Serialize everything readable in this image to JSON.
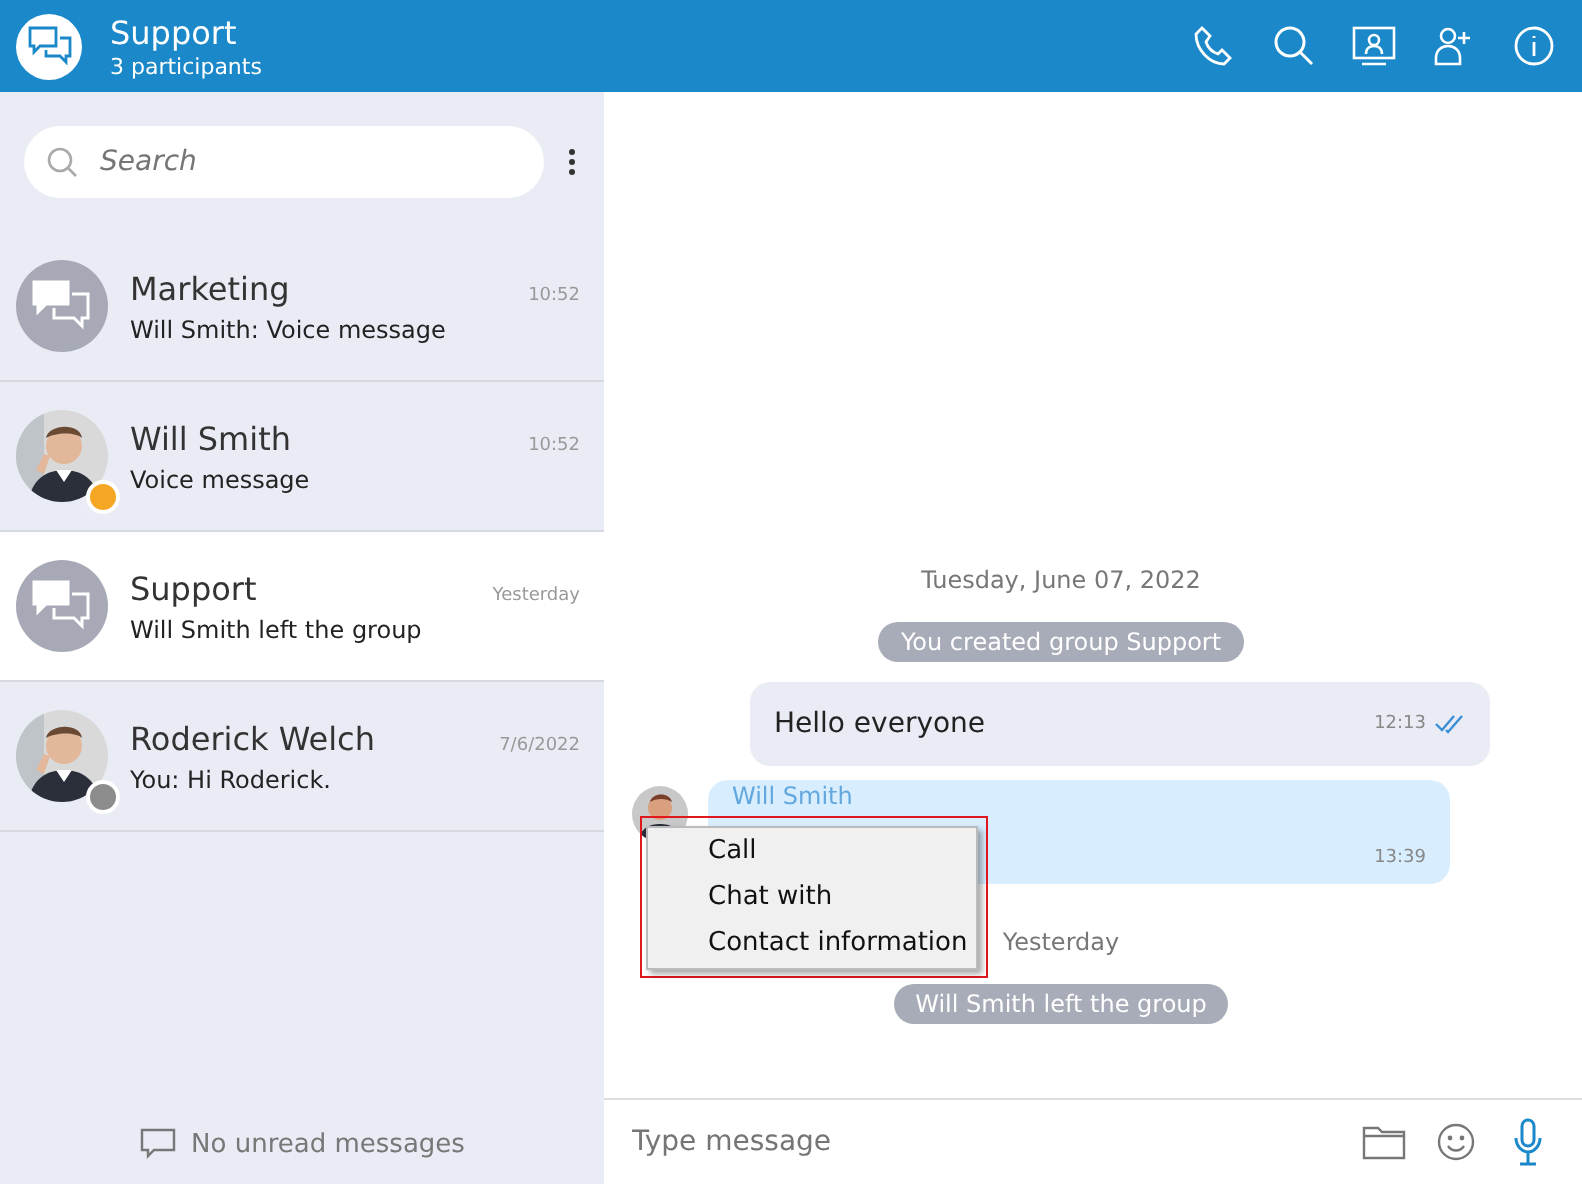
{
  "header": {
    "title": "Support",
    "subtitle": "3 participants"
  },
  "search": {
    "placeholder": "Search"
  },
  "chats": [
    {
      "name": "Marketing",
      "time": "10:52",
      "preview": "Will Smith: Voice message",
      "kind": "group",
      "selected": false
    },
    {
      "name": "Will Smith",
      "time": "10:52",
      "preview": "Voice message",
      "kind": "person",
      "color": "#f5a623",
      "selected": false
    },
    {
      "name": "Support",
      "time": "Yesterday",
      "preview": "Will Smith left the group",
      "kind": "group",
      "selected": true
    },
    {
      "name": "Roderick Welch",
      "time": "7/6/2022",
      "preview": "You: Hi Roderick.",
      "kind": "person",
      "color": "#8c8c8c",
      "selected": false
    }
  ],
  "unread_note": "No unread messages",
  "messages": [
    {
      "kind": "date",
      "text": "Tuesday, June 07, 2022"
    },
    {
      "kind": "event",
      "text": "You created group Support"
    },
    {
      "kind": "outgoing",
      "text": "Hello everyone",
      "time": "12:13",
      "read": true
    },
    {
      "kind": "incoming",
      "sender": "Will Smith",
      "time": "13:39"
    },
    {
      "kind": "date",
      "text": "Yesterday"
    },
    {
      "kind": "event",
      "text": "Will Smith left the group"
    }
  ],
  "context_menu": [
    "Call",
    "Chat with",
    "Contact information"
  ],
  "composer": {
    "placeholder": "Type message"
  }
}
